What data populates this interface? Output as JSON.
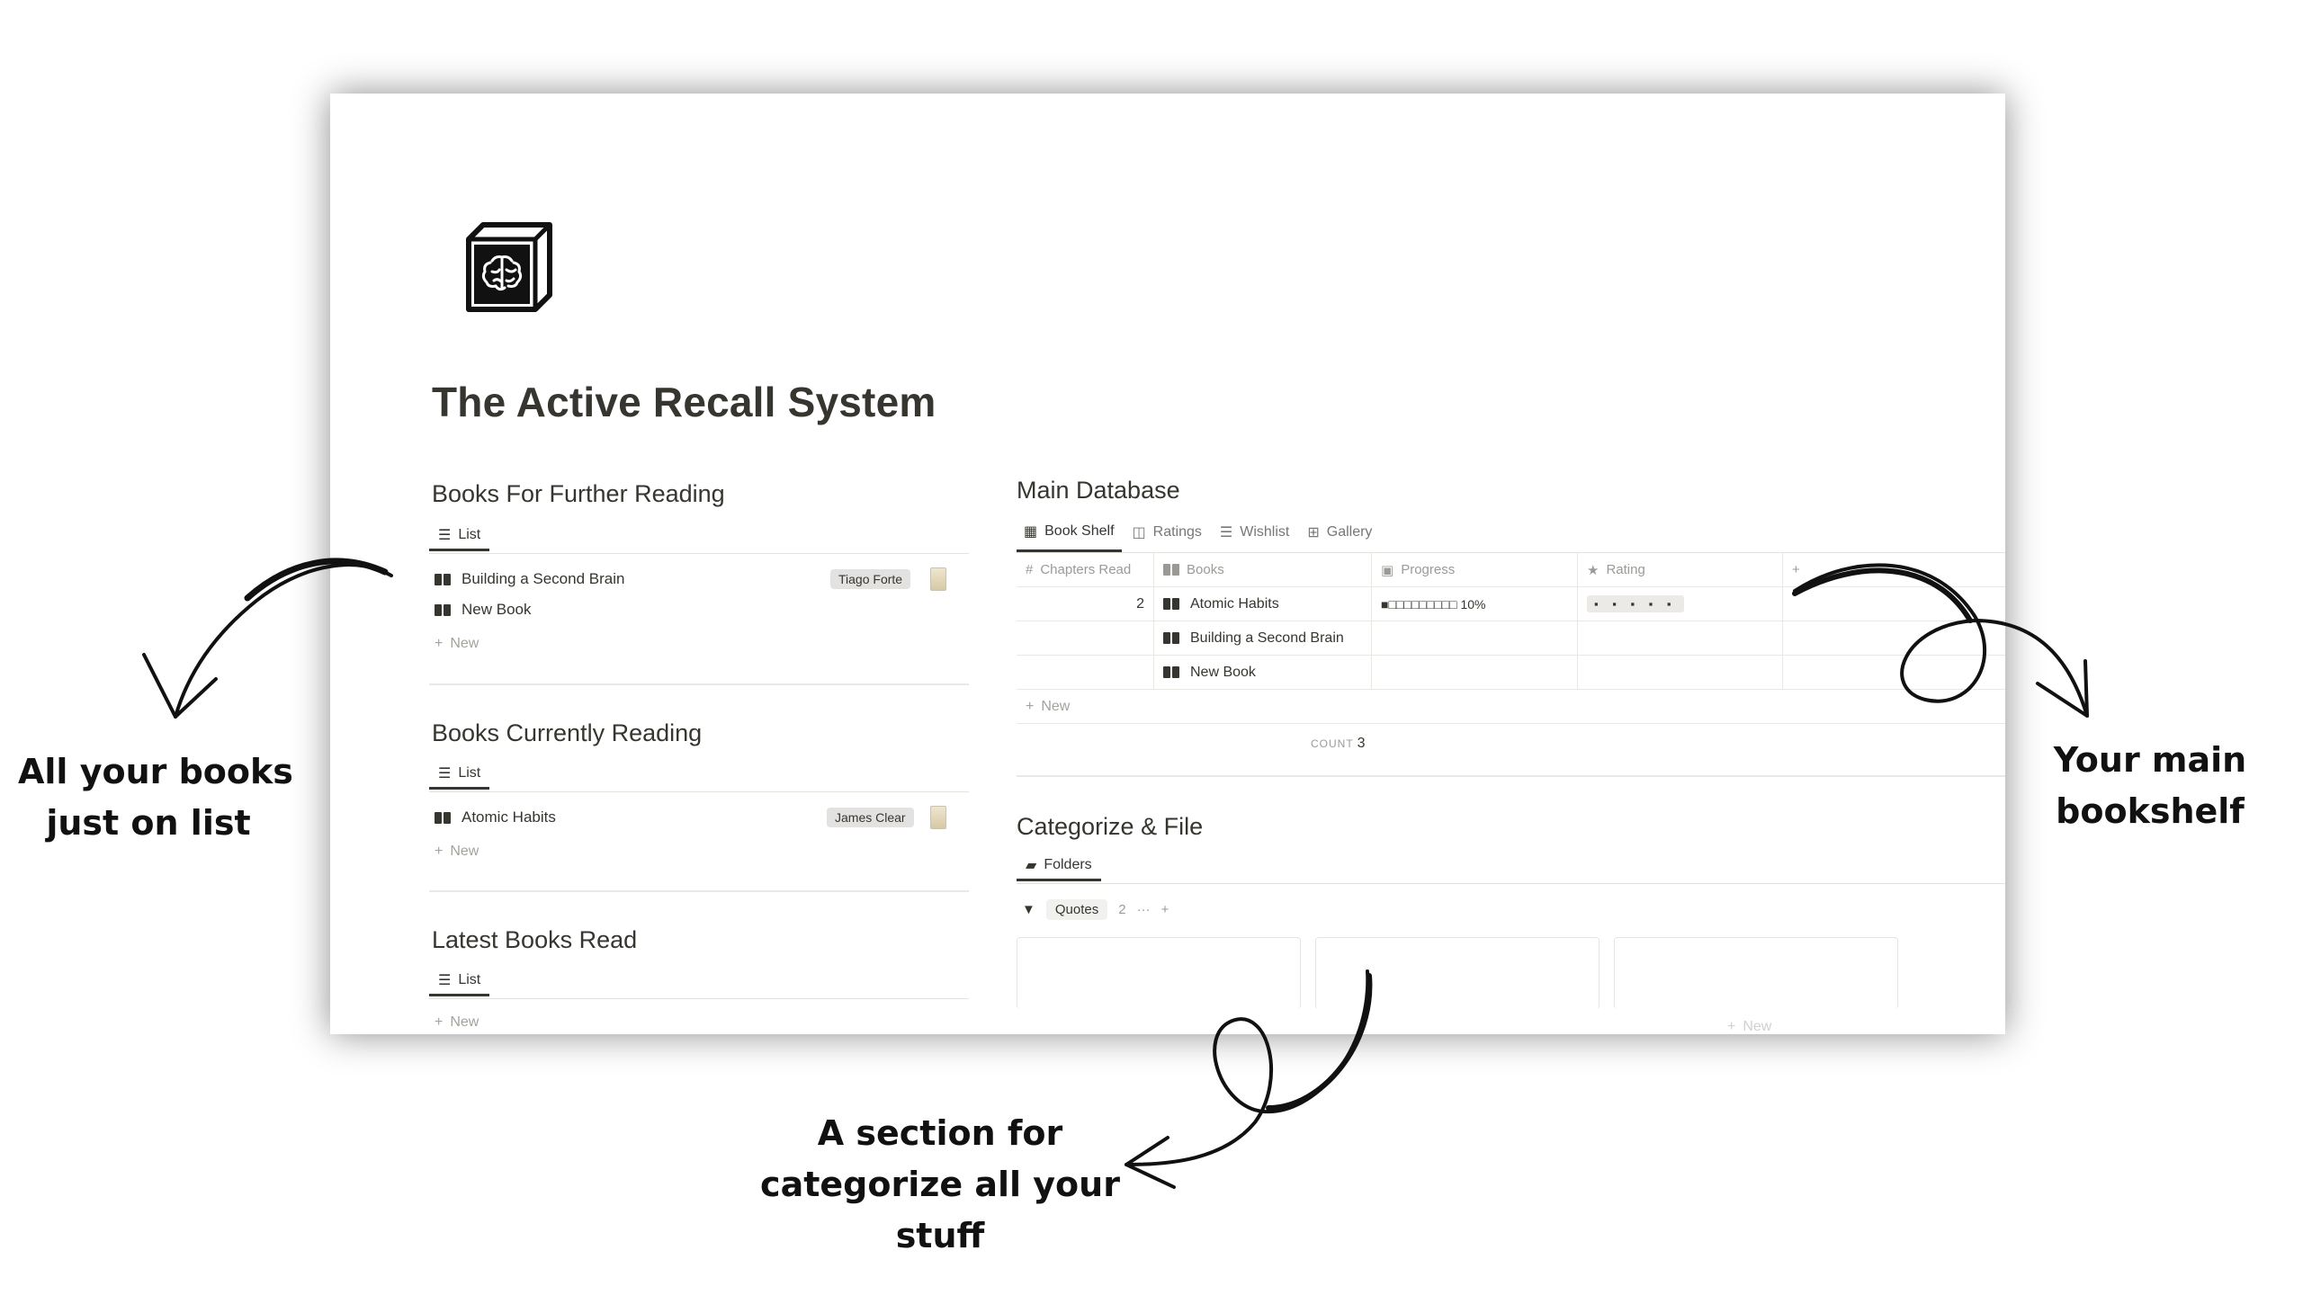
{
  "page": {
    "title": "The Active Recall System",
    "icon": "brain-cube-icon"
  },
  "further_reading": {
    "heading": "Books For Further Reading",
    "view_label": "List",
    "items": [
      {
        "title": "Building a Second Brain",
        "author": "Tiago Forte"
      },
      {
        "title": "New Book"
      }
    ],
    "new_label": "New"
  },
  "currently_reading": {
    "heading": "Books Currently Reading",
    "view_label": "List",
    "items": [
      {
        "title": "Atomic Habits",
        "author": "James Clear"
      }
    ],
    "new_label": "New"
  },
  "latest_read": {
    "heading": "Latest Books Read",
    "view_label": "List",
    "new_label": "New"
  },
  "main_database": {
    "heading": "Main Database",
    "tabs": [
      "Book Shelf",
      "Ratings",
      "Wishlist",
      "Gallery"
    ],
    "columns": [
      "Chapters Read",
      "Books",
      "Progress",
      "Rating"
    ],
    "rows": [
      {
        "chapters": "2",
        "book": "Atomic Habits",
        "progress": "■□□□□□□□□□ 10%",
        "progress_value": 0.1,
        "rating": "▪ ▪ ▪ ▪ ▪"
      },
      {
        "chapters": "",
        "book": "Building a Second Brain",
        "progress": "",
        "rating": ""
      },
      {
        "chapters": "",
        "book": "New Book",
        "progress": "",
        "rating": ""
      }
    ],
    "new_label": "New",
    "count_label": "COUNT",
    "count_value": "3"
  },
  "categorize": {
    "heading": "Categorize & File",
    "view_label": "Folders",
    "group_label": "Quotes",
    "group_count": "2",
    "card_new_label": "New"
  },
  "annotations": {
    "left": [
      "All your books",
      "just on list"
    ],
    "right": [
      "Your main",
      "bookshelf"
    ],
    "bottom": [
      "A section for",
      "categorize all your",
      "stuff"
    ]
  }
}
